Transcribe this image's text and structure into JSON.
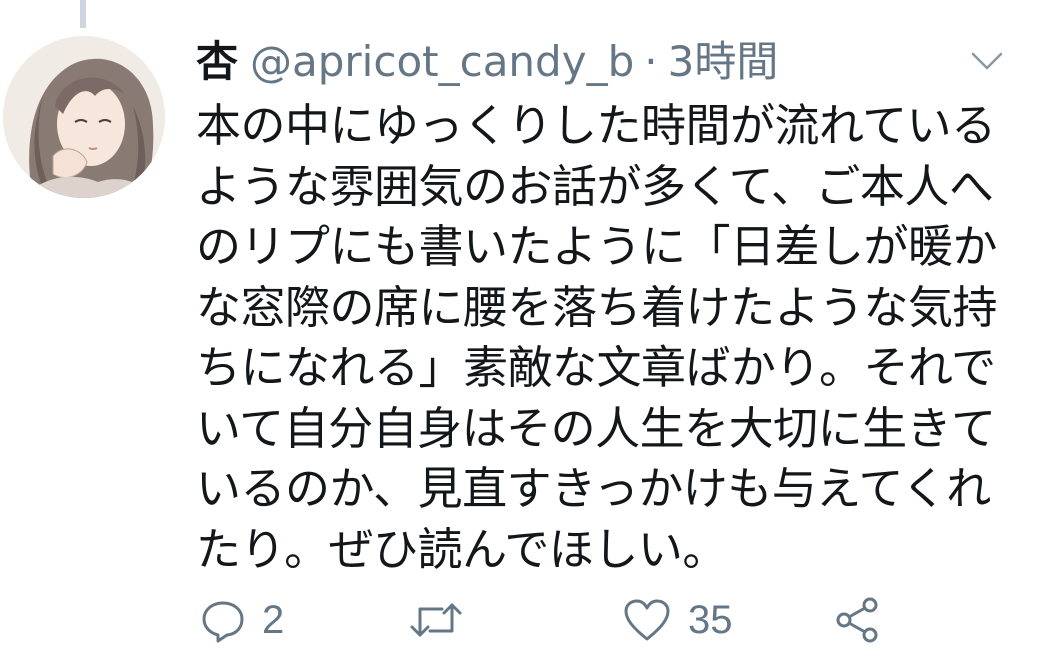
{
  "tweet": {
    "display_name": "杏",
    "handle": "@apricot_candy_b",
    "separator": "·",
    "timestamp": "3時間",
    "text_lines": [
      "本の中にゆっくりした時間が流れている",
      "ような雰囲気のお話が多くて、ご本人へ",
      "のリプにも書いたように「日差しが暖か",
      "な窓際の席に腰を落ち着けたような気持",
      "ちになれる」素敵な文章ばかり。それで",
      "いて自分自身はその人生を大切に生きて",
      "いるのか、見直すきっかけも与えてくれ",
      "たり。ぜひ読んでほしい。"
    ]
  },
  "actions": {
    "reply_count": "2",
    "retweet_count": "",
    "like_count": "35"
  },
  "icons": {
    "reply": "reply-icon",
    "retweet": "retweet-icon",
    "like": "heart-icon",
    "share": "share-icon",
    "caret": "chevron-down-icon"
  },
  "colors": {
    "text_primary": "#14171a",
    "text_secondary": "#657786",
    "icon_gray": "#657786",
    "thread_line": "#ccd6dd"
  }
}
